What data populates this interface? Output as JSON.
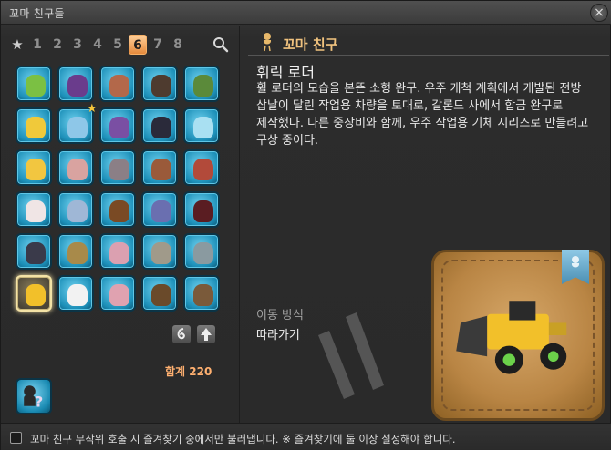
{
  "window": {
    "title": "꼬마 친구들",
    "close_label": "×"
  },
  "tabs": {
    "favorites_label": "★",
    "pages": [
      "1",
      "2",
      "3",
      "4",
      "5",
      "6",
      "7",
      "8"
    ],
    "active_page": "6"
  },
  "grid": {
    "selected_index": 25,
    "slots": [
      {
        "name": "green-bird-minion",
        "color": "#7bc043"
      },
      {
        "name": "purple-octopus-minion",
        "color": "#6a3c8c"
      },
      {
        "name": "flying-creature-minion",
        "color": "#b3684a"
      },
      {
        "name": "dark-dragon-minion",
        "color": "#4e3b2f"
      },
      {
        "name": "green-dragon-minion",
        "color": "#5b8a3a"
      },
      {
        "name": "yellow-chocobo-minion",
        "color": "#f0c93a"
      },
      {
        "name": "blue-fairy-minion",
        "color": "#8ec7e8",
        "favorite": true
      },
      {
        "name": "purple-mage-minion",
        "color": "#7a4fa3"
      },
      {
        "name": "black-mage-minion",
        "color": "#2a2a3a"
      },
      {
        "name": "ice-dragon-minion",
        "color": "#a9e0f2"
      },
      {
        "name": "yellow-bird-minion",
        "color": "#f2c640"
      },
      {
        "name": "pink-girl-minion",
        "color": "#d9a3a0"
      },
      {
        "name": "grey-creature-minion",
        "color": "#8b7f86"
      },
      {
        "name": "brown-cat-minion",
        "color": "#9a5a3a"
      },
      {
        "name": "red-dwarf-minion",
        "color": "#b24a3a"
      },
      {
        "name": "white-moogle-minion",
        "color": "#f0e5e5"
      },
      {
        "name": "blue-maid-minion",
        "color": "#9fb7d6"
      },
      {
        "name": "ship-minion",
        "color": "#7a4a24"
      },
      {
        "name": "airship-minion",
        "color": "#6a6fb0"
      },
      {
        "name": "dark-orb-minion",
        "color": "#5a1d22"
      },
      {
        "name": "dark-gorilla-minion",
        "color": "#3a3a4a"
      },
      {
        "name": "golden-crawler-minion",
        "color": "#a88a4a"
      },
      {
        "name": "pink-plant-minion",
        "color": "#dba0b0"
      },
      {
        "name": "stone-golem-minion",
        "color": "#a09a8a"
      },
      {
        "name": "ufo-minion",
        "color": "#8a9aa0"
      },
      {
        "name": "loader-minion",
        "color": "#f2c02a"
      },
      {
        "name": "pointing-hand-minion",
        "color": "#f2f2f2"
      },
      {
        "name": "pink-cushion-minion",
        "color": "#e0a2b0"
      },
      {
        "name": "mine-cart-minion",
        "color": "#6a4a2a"
      },
      {
        "name": "wagon-minion",
        "color": "#7a5a3a"
      }
    ]
  },
  "sort_buttons": {
    "left_icon": "whirl-icon",
    "right_icon": "up-arrow-icon"
  },
  "total": "합계 220",
  "detail": {
    "category": "꼬마 친구",
    "name": "휘릭 로더",
    "description": "휠 로더의 모습을 본뜬 소형 완구. 우주 개척 계획에서 개발된 전방 삽날이 달린 작업용 차량을 토대로, 갈론드 사에서 합금 완구로 제작했다. 다른 중장비와 함께, 우주 작업용 기체 시리즈로 만들려고 구상 중이다.",
    "movement_label": "이동 방식",
    "movement_value": "따라가기"
  },
  "footer": {
    "checkbox_checked": false,
    "text": "꼬마 친구 무작위 호출 시 즐겨찾기 중에서만 불러냅니다. ※ 즐겨찾기에 둘 이상 설정해야 합니다."
  },
  "colors": {
    "accent": "#f0c27e",
    "tab_active": "#e58a3c",
    "total": "#ffb070",
    "slot_bg": "#1c8fb8"
  }
}
